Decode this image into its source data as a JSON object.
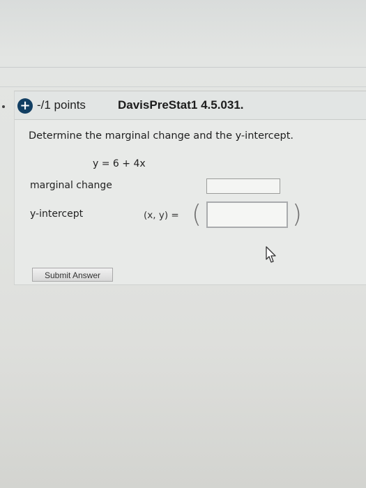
{
  "question": {
    "points": "-/1 points",
    "id": "DavisPreStat1 4.5.031.",
    "prompt": "Determine the marginal change and the y-intercept.",
    "equation": "y = 6 + 4x",
    "marginal_change_label": "marginal change",
    "marginal_change_value": "",
    "y_intercept_label": "y-intercept",
    "xy_label": "(x, y) =",
    "y_intercept_value": "",
    "submit_label": "Submit Answer"
  },
  "icons": {
    "expand": "plus-circle-icon",
    "cursor": "mouse-pointer-icon"
  },
  "colors": {
    "expand_icon_bg": "#123f63"
  }
}
